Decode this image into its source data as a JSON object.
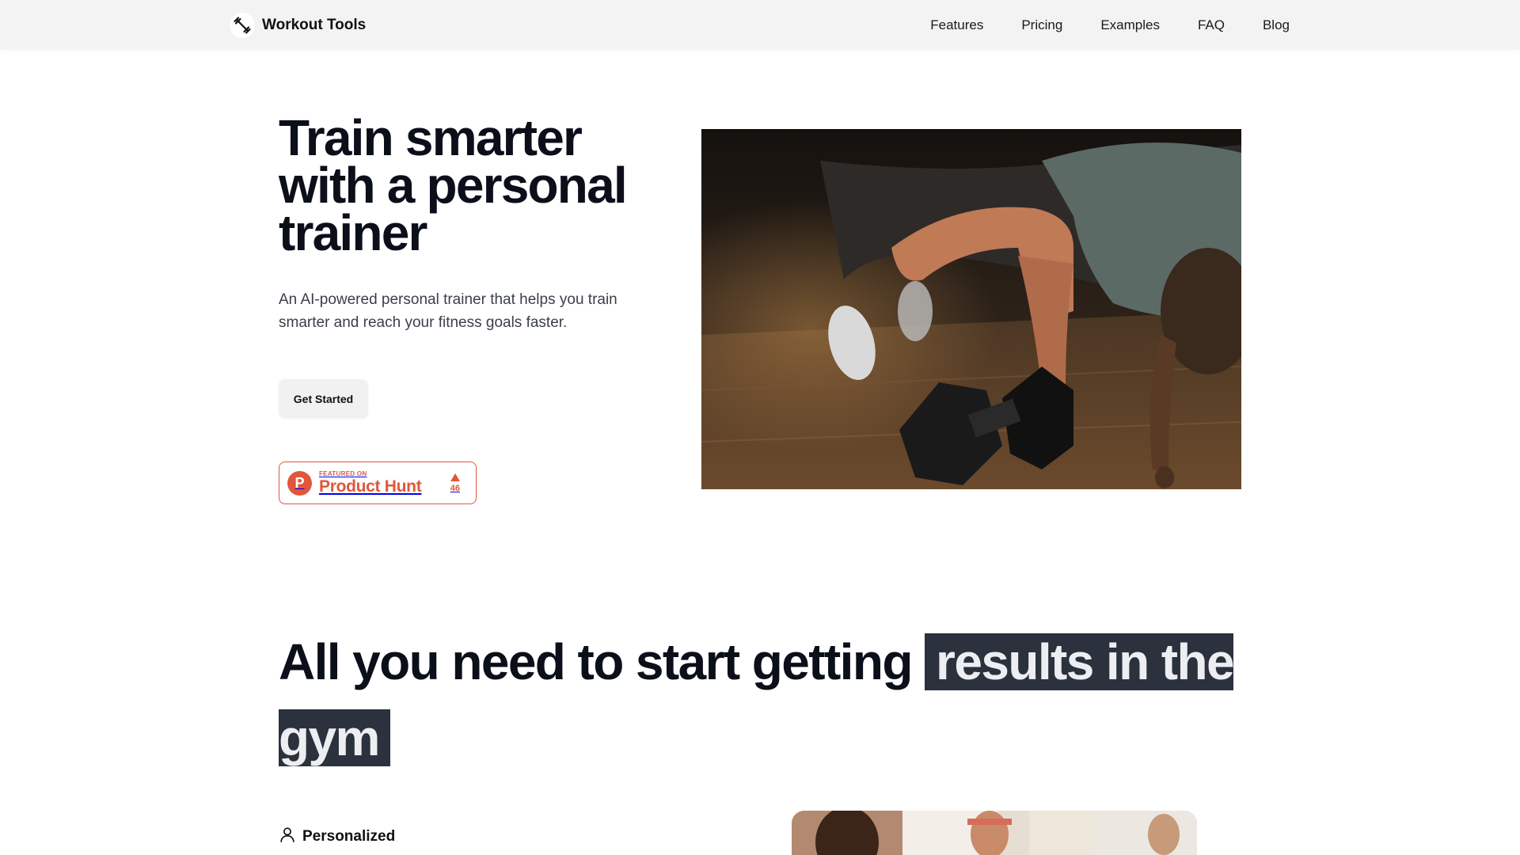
{
  "header": {
    "brand_name": "Workout Tools",
    "logo_icon": "dumbbell-icon",
    "nav": [
      {
        "label": "Features"
      },
      {
        "label": "Pricing"
      },
      {
        "label": "Examples"
      },
      {
        "label": "FAQ"
      },
      {
        "label": "Blog"
      }
    ]
  },
  "hero": {
    "title": "Train smarter with a personal trainer",
    "subtitle": "An AI-powered personal trainer that helps you train smarter and reach your fitness goals faster.",
    "cta_label": "Get Started",
    "product_hunt": {
      "letter": "P",
      "featured_on": "FEATURED ON",
      "name": "Product Hunt",
      "votes": "46",
      "color": "#e0573b"
    }
  },
  "section": {
    "title_plain": "All you need to start getting ",
    "title_highlight_1": "results in the",
    "title_highlight_2": "gym",
    "highlight_color": "#2b313d",
    "feature_label": "Personalized",
    "feature_icon": "user-icon"
  }
}
